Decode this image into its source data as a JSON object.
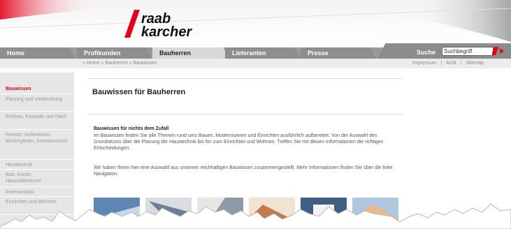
{
  "brand": {
    "line1": "raab",
    "line2": "karcher",
    "accent": "#e2001a"
  },
  "nav": {
    "tabs": [
      {
        "label": "Home"
      },
      {
        "label": "Profikunden"
      },
      {
        "label": "Bauherren",
        "active": true
      },
      {
        "label": "Lieferanten"
      },
      {
        "label": "Presse"
      }
    ],
    "search_label": "Suche",
    "search_value": "Suchbegriff",
    "search_go_icon": "arrow-right-icon"
  },
  "breadcrumb": "» Home » Bauherren » Bauwissen",
  "utility": [
    "Impressum",
    "|",
    "AGB",
    "|",
    "Sitemap"
  ],
  "sidebar": {
    "items": [
      {
        "label": "Bauwissen",
        "active": true
      },
      {
        "label": "Planung und Vorbereitung"
      },
      {
        "label": "Rohbau, Fassade und Dach"
      },
      {
        "label": "Fenster, Außentüren, Wintergärten, Sonnenschutz"
      },
      {
        "label": "Haustechnik"
      },
      {
        "label": "Bad, Küche, Haushaltsräume"
      },
      {
        "label": "Innenausbau"
      },
      {
        "label": "Einrichten und Wohnen"
      }
    ]
  },
  "main": {
    "title": "Bauwissen für Bauherren",
    "intro_heading": "Bauwissen für nichts dem Zufall",
    "para1": "Im Bauwissen finden Sie alle Themen rund ums Bauen, Modernisieren und Einrichten ausführlich aufbereitet. Von der Auswahl des Grundstücks über die Planung der Haustechnik bis hin zum Einrichten und Wohnen. Treffen Sie mit diesen Informationen die richtigen Entscheidungen.",
    "para2": "Wir haben Ihnen hier eine Auswahl aus unserem reichhaltigen Bauwissen zusammengestellt. Mehr Informationen finden Sie über die linke Navigation."
  }
}
